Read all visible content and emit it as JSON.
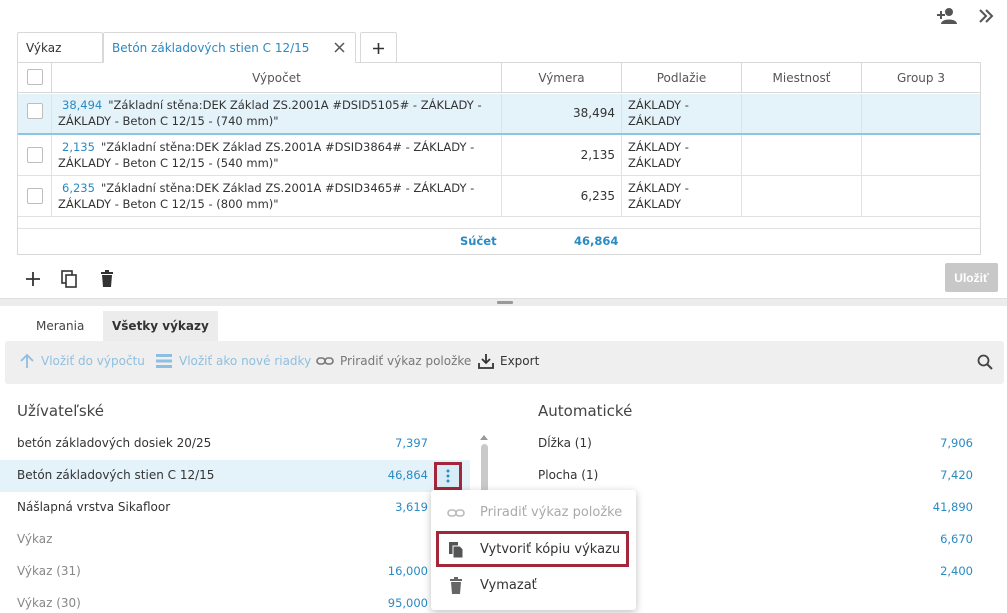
{
  "top_icons": [
    "add-person-icon",
    "double-chevron-right-icon"
  ],
  "tabs": [
    {
      "label": "Výkaz"
    },
    {
      "label": "Betón základových stien C 12/15"
    }
  ],
  "table": {
    "headers": [
      "Výpočet",
      "Výmera",
      "Podlažie",
      "Miestnosť",
      "Group 3"
    ],
    "rows": [
      {
        "calc_num": "38,494",
        "calc_line1": "\"Základní stěna:DEK Základ ZS.2001A #DSID5105# - ZÁKLADY -",
        "calc_line2": "ZÁKLADY - Beton C 12/15 - (740 mm)\"",
        "vymera": "38,494",
        "podl1": "ZÁKLADY -",
        "podl2": "ZÁKLADY"
      },
      {
        "calc_num": "2,135",
        "calc_line1": "\"Základní stěna:DEK Základ ZS.2001A #DSID3864# - ZÁKLADY -",
        "calc_line2": "ZÁKLADY - Beton C 12/15 - (540 mm)\"",
        "vymera": "2,135",
        "podl1": "ZÁKLADY -",
        "podl2": "ZÁKLADY"
      },
      {
        "calc_num": "6,235",
        "calc_line1": "\"Základní stěna:DEK Základ ZS.2001A #DSID3465# - ZÁKLADY -",
        "calc_line2": "ZÁKLADY - Beton C 12/15 - (800 mm)\"",
        "vymera": "6,235",
        "podl1": "ZÁKLADY -",
        "podl2": "ZÁKLADY"
      }
    ],
    "sum_label": "Súčet",
    "sum_value": "46,864"
  },
  "save_label": "Uložiť",
  "bottom_tabs": [
    {
      "label": "Merania"
    },
    {
      "label": "Všetky výkazy"
    }
  ],
  "toolbar": {
    "insert_calc": "Vložiť do výpočtu",
    "insert_rows": "Vložiť ako nové riadky",
    "assign": "Priradiť výkaz položke",
    "export": "Export"
  },
  "user_section": {
    "title": "Užívateľské",
    "items": [
      {
        "name": "betón základových dosiek 20/25",
        "value": "7,397"
      },
      {
        "name": "Betón základových stien C 12/15",
        "value": "46,864"
      },
      {
        "name": "Nášlapná vrstva Sikafloor",
        "value": "3,619"
      },
      {
        "name": "Výkaz",
        "value": ""
      },
      {
        "name": "Výkaz (31)",
        "value": "16,000"
      },
      {
        "name": "Výkaz (30)",
        "value": "95,000"
      }
    ]
  },
  "auto_section": {
    "title": "Automatické",
    "items": [
      {
        "name": "Dĺžka (1)",
        "value": "7,906"
      },
      {
        "name": "Plocha (1)",
        "value": "7,420"
      },
      {
        "name": "",
        "value": "41,890"
      },
      {
        "name": "",
        "value": "6,670"
      },
      {
        "name": "",
        "value": "2,400"
      }
    ]
  },
  "context_menu": {
    "assign": "Priradiť výkaz položke",
    "copy": "Vytvoriť kópiu výkazu",
    "delete": "Vymazať"
  },
  "colors": {
    "accent": "#2a8ac4",
    "highlight": "#a3263a",
    "selected_row": "#e4f2fa"
  }
}
